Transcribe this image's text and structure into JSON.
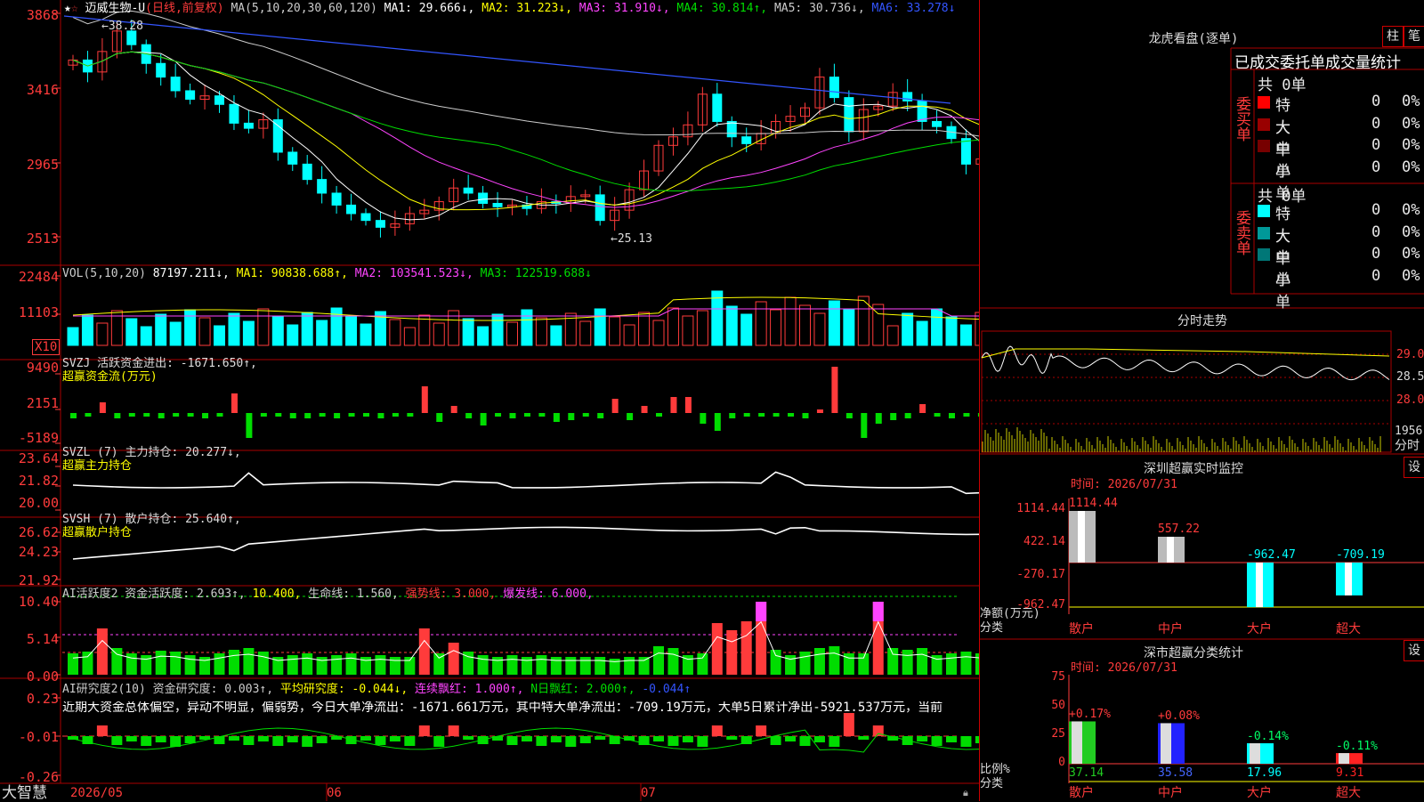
{
  "stock": {
    "name": "迈威生物-U",
    "period": "(日线,前复权)",
    "star": "★",
    "flag": "☆"
  },
  "header_ma": [
    {
      "label": "MA(5,10,20,30,60,120)",
      "color": "#cccccc"
    },
    {
      "label": "MA1: 29.666↓,",
      "color": "#ffffff"
    },
    {
      "label": "MA2: 31.223↓,",
      "color": "#ffff00"
    },
    {
      "label": "MA3: 31.910↓,",
      "color": "#ff44ff"
    },
    {
      "label": "MA4: 30.814↑,",
      "color": "#00dd00"
    },
    {
      "label": "MA5: 30.736↓,",
      "color": "#cccccc"
    },
    {
      "label": "MA6: 33.278↓",
      "color": "#3355ff"
    }
  ],
  "price_axis": [
    "3868",
    "3416",
    "2965",
    "2513"
  ],
  "price_marks": {
    "high": "38.28",
    "low": "25.13"
  },
  "vol": {
    "header": [
      {
        "label": "VOL(5,10,20)",
        "color": "#cccccc"
      },
      {
        "label": "87197.211↓,",
        "color": "#ffffff"
      },
      {
        "label": "MA1: 90838.688↑,",
        "color": "#ffff00"
      },
      {
        "label": "MA2: 103541.523↓,",
        "color": "#ff44ff"
      },
      {
        "label": "MA3: 122519.688↓",
        "color": "#00dd00"
      }
    ],
    "axis": [
      "22484",
      "11103"
    ],
    "unit": "X10"
  },
  "svzj": {
    "header": "SVZJ  活跃资金进出: -1671.650↑,",
    "sub": "超赢资金流(万元)",
    "axis": [
      "9490",
      "2151",
      "-5189"
    ]
  },
  "svzl": {
    "header": "SVZL (7) 主力持仓: 20.277↓,",
    "sub": "超赢主力持仓",
    "axis": [
      "23.64",
      "21.82",
      "20.00"
    ]
  },
  "svsh": {
    "header": "SVSH (7) 散户持仓: 25.640↑,",
    "sub": "超赢散户持仓",
    "axis": [
      "26.62",
      "24.23",
      "21.92"
    ]
  },
  "ai1": {
    "header": [
      {
        "label": "AI活跃度2 资金活跃度: 2.693↑,",
        "color": "#cccccc"
      },
      {
        "label": "10.400,",
        "color": "#ffff00"
      },
      {
        "label": "生命线: 1.560,",
        "color": "#cccccc"
      },
      {
        "label": "强势线: 3.000,",
        "color": "#ff3b3b"
      },
      {
        "label": "爆发线: 6.000,",
        "color": "#ff44ff"
      }
    ],
    "axis": [
      "10.40",
      "5.14",
      "0.00"
    ]
  },
  "ai2": {
    "header": [
      {
        "label": "AI研究度2(10) 资金研究度: 0.003↑,",
        "color": "#cccccc"
      },
      {
        "label": "平均研究度: -0.044↓,",
        "color": "#ffff00"
      },
      {
        "label": "连续飘红: 1.000↑,",
        "color": "#ff44ff"
      },
      {
        "label": "N日飘红: 2.000↑,",
        "color": "#00dd00"
      },
      {
        "label": "-0.044↑",
        "color": "#3355ff"
      }
    ],
    "summary": "近期大资金总体偏空，异动不明显，偏弱势，今日大单净流出：-1671.661万元，其中特大单净流出：-709.19万元，大单5日累计净出-5921.537万元，当前",
    "axis": [
      "0.23",
      "-0.01",
      "-0.26"
    ]
  },
  "date_axis": [
    "2026/05",
    "06",
    "07"
  ],
  "brand": "大智慧",
  "right": {
    "dragon_title": "龙虎看盘(逐单)",
    "tab_bar": "柱",
    "tab_pen": "笔",
    "stats_title": "已成交委托单成交量统计",
    "buy_label": "委买单",
    "sell_label": "委卖单",
    "buy_total": "共 0单",
    "sell_total": "共 0单",
    "buy_rows": [
      {
        "name": "特大",
        "count": "0",
        "pct": "0%",
        "color": "#ff0000"
      },
      {
        "name": "大单",
        "count": "0",
        "pct": "0%",
        "color": "#990000"
      },
      {
        "name": "中单",
        "count": "0",
        "pct": "0%",
        "color": "#770000"
      },
      {
        "name": "小单",
        "count": "0",
        "pct": "0%",
        "color": ""
      }
    ],
    "sell_rows": [
      {
        "name": "特大",
        "count": "0",
        "pct": "0%",
        "color": "#00ffff"
      },
      {
        "name": "大单",
        "count": "0",
        "pct": "0%",
        "color": "#009999"
      },
      {
        "name": "中单",
        "count": "0",
        "pct": "0%",
        "color": "#007777"
      },
      {
        "name": "小单",
        "count": "0",
        "pct": "0%",
        "color": ""
      }
    ],
    "intraday_title": "分时走势",
    "intraday_axis": [
      "29.0",
      "28.5",
      "28.0"
    ],
    "intraday_vol": "1956",
    "intraday_unit": "分时",
    "monitor_title": "深圳超赢实时监控",
    "monitor_time": "时间: 2026/07/31",
    "monitor_set": "设",
    "monitor_axis": [
      "1114.44",
      "422.14",
      "-270.17",
      "-962.47"
    ],
    "monitor_ylabel": "净额(万元)",
    "monitor_xlabel": "分类",
    "monitor_bars": [
      {
        "cat": "散户",
        "value": 1114.44,
        "label": "1114.44"
      },
      {
        "cat": "中户",
        "value": 557.22,
        "label": "557.22"
      },
      {
        "cat": "大户",
        "value": -962.47,
        "label": "-962.47"
      },
      {
        "cat": "超大",
        "value": -709.19,
        "label": "-709.19"
      }
    ],
    "class_title": "深市超赢分类统计",
    "class_time": "时间: 2026/07/31",
    "class_set": "设",
    "class_axis": [
      "75",
      "50",
      "25",
      "0"
    ],
    "class_ylabel": "比例%",
    "class_xlabel": "分类",
    "class_bars": [
      {
        "cat": "散户",
        "value": 37.14,
        "label": "37.14",
        "change": "+0.17%",
        "color": "#22cc22"
      },
      {
        "cat": "中户",
        "value": 35.58,
        "label": "35.58",
        "change": "+0.08%",
        "color": "#2222ff"
      },
      {
        "cat": "大户",
        "value": 17.96,
        "label": "17.96",
        "change": "-0.14%",
        "color": "#00ffff"
      },
      {
        "cat": "超大",
        "value": 9.31,
        "label": "9.31",
        "change": "-0.11%",
        "color": "#ff2222"
      }
    ]
  },
  "colors": {
    "up": "#ff3b3b",
    "down": "#00ffff",
    "grid": "#aa0000",
    "axis": "#ff3b3b"
  },
  "chart_data": {
    "type": "candlestick",
    "series_close": [
      35.9,
      35.2,
      36.4,
      37.6,
      36.8,
      35.7,
      34.9,
      34.1,
      33.6,
      33.8,
      33.3,
      32.2,
      31.9,
      32.4,
      30.5,
      29.8,
      28.9,
      28.1,
      27.4,
      26.9,
      26.5,
      26.1,
      26.3,
      26.9,
      27.1,
      27.6,
      28.4,
      28.1,
      27.5,
      27.3,
      27.4,
      27.2,
      27.6,
      27.5,
      27.9,
      28.0,
      26.5,
      27.1,
      28.3,
      29.4,
      30.9,
      31.4,
      32.1,
      33.9,
      32.3,
      31.4,
      31.0,
      31.6,
      32.3,
      32.6,
      33.1,
      34.9,
      33.7,
      31.7,
      33.0,
      33.2,
      34.0,
      33.5,
      32.3,
      32.0,
      31.3,
      29.8,
      30.1,
      29.2,
      29.0
    ]
  }
}
